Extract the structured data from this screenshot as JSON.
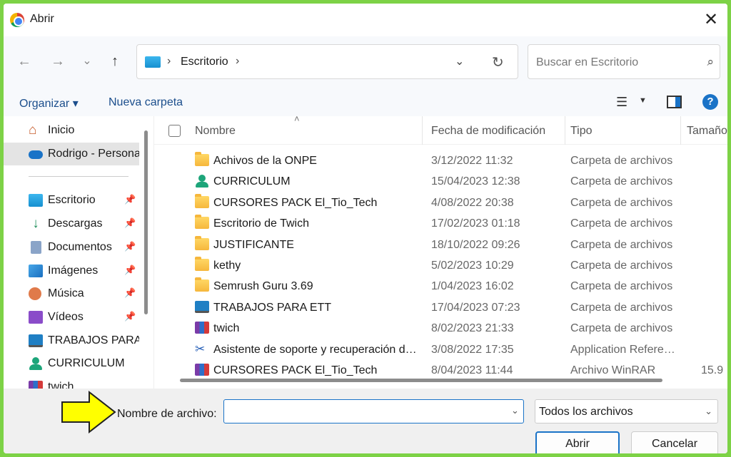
{
  "window": {
    "title": "Abrir",
    "close_glyph": "✕"
  },
  "nav": {
    "back_glyph": "←",
    "forward_glyph": "→",
    "recent_glyph": "⌄",
    "up_glyph": "↑",
    "breadcrumb": "Escritorio",
    "search_placeholder": "Buscar en Escritorio"
  },
  "commands": {
    "organize": "Organizar ▾",
    "new_folder": "Nueva carpeta"
  },
  "sidebar": {
    "items": [
      {
        "label": "Inicio",
        "icon": "home-icon"
      },
      {
        "label": "Rodrigo - Personal",
        "icon": "onedrive-icon"
      },
      {
        "label": "Escritorio",
        "icon": "desktop-icon",
        "pinned": true
      },
      {
        "label": "Descargas",
        "icon": "download-icon",
        "pinned": true
      },
      {
        "label": "Documentos",
        "icon": "documents-icon",
        "pinned": true
      },
      {
        "label": "Imágenes",
        "icon": "pictures-icon",
        "pinned": true
      },
      {
        "label": "Música",
        "icon": "music-icon",
        "pinned": true
      },
      {
        "label": "Vídeos",
        "icon": "videos-icon",
        "pinned": true
      },
      {
        "label": "TRABAJOS PARA ETT",
        "icon": "monitor-icon"
      },
      {
        "label": "CURRICULUM",
        "icon": "user-folder-icon"
      },
      {
        "label": "twich",
        "icon": "winrar-icon"
      }
    ]
  },
  "table": {
    "columns": {
      "name": "Nombre",
      "date": "Fecha de modificación",
      "type": "Tipo",
      "size": "Tamaño"
    },
    "rows": [
      {
        "name": "Achivos de la ONPE",
        "date": "3/12/2022 11:32",
        "type": "Carpeta de archivos",
        "size": "",
        "icon": "folder"
      },
      {
        "name": "CURRICULUM",
        "date": "15/04/2023 12:38",
        "type": "Carpeta de archivos",
        "size": "",
        "icon": "user"
      },
      {
        "name": "CURSORES PACK El_Tio_Tech",
        "date": "4/08/2022 20:38",
        "type": "Carpeta de archivos",
        "size": "",
        "icon": "folder"
      },
      {
        "name": "Escritorio de Twich",
        "date": "17/02/2023 01:18",
        "type": "Carpeta de archivos",
        "size": "",
        "icon": "folder"
      },
      {
        "name": "JUSTIFICANTE",
        "date": "18/10/2022 09:26",
        "type": "Carpeta de archivos",
        "size": "",
        "icon": "folder"
      },
      {
        "name": "kethy",
        "date": "5/02/2023 10:29",
        "type": "Carpeta de archivos",
        "size": "",
        "icon": "folder"
      },
      {
        "name": "Semrush Guru 3.69",
        "date": "1/04/2023 16:02",
        "type": "Carpeta de archivos",
        "size": "",
        "icon": "folder"
      },
      {
        "name": "TRABAJOS PARA ETT",
        "date": "17/04/2023 07:23",
        "type": "Carpeta de archivos",
        "size": "",
        "icon": "monitor"
      },
      {
        "name": "twich",
        "date": "8/02/2023 21:33",
        "type": "Carpeta de archivos",
        "size": "",
        "icon": "rar"
      },
      {
        "name": "Asistente de soporte y recuperación de Microsoft",
        "date": "3/08/2022 17:35",
        "type": "Application Reference",
        "size": "",
        "icon": "tool"
      },
      {
        "name": "CURSORES PACK El_Tio_Tech",
        "date": "8/04/2023 11:44",
        "type": "Archivo WinRAR",
        "size": "15.9",
        "icon": "rar"
      }
    ]
  },
  "footer": {
    "filename_label": "Nombre de archivo:",
    "filename_value": "",
    "filetype": "Todos los archivos",
    "open_label": "Abrir",
    "cancel_label": "Cancelar"
  },
  "colors": {
    "frame": "#7dd246",
    "accent": "#1a73c7",
    "arrow_fill": "#ffff00"
  }
}
